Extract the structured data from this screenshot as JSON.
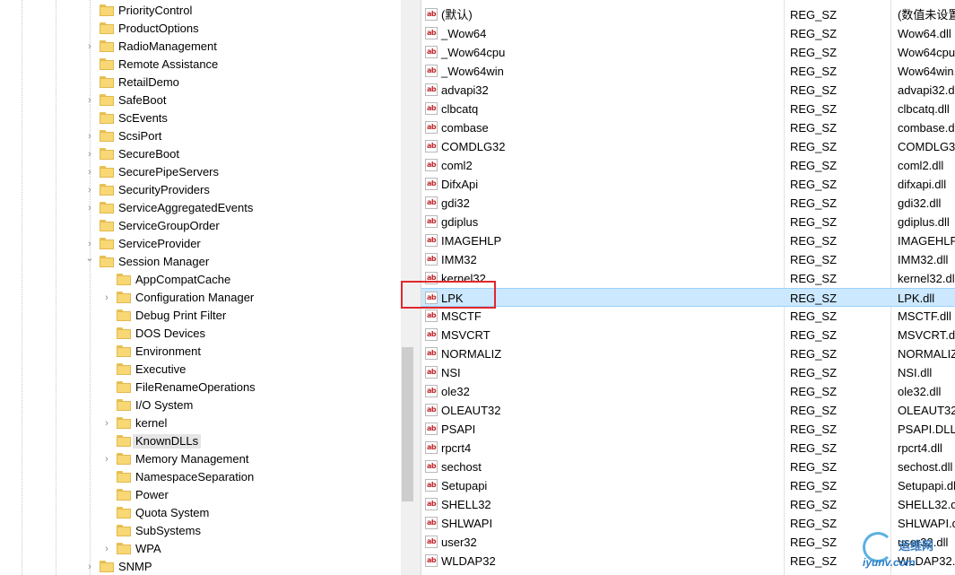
{
  "tree": {
    "items": [
      {
        "label": "PriorityControl",
        "expandable": false,
        "level": 1
      },
      {
        "label": "ProductOptions",
        "expandable": false,
        "level": 1
      },
      {
        "label": "RadioManagement",
        "expandable": true,
        "level": 1
      },
      {
        "label": "Remote Assistance",
        "expandable": false,
        "level": 1
      },
      {
        "label": "RetailDemo",
        "expandable": false,
        "level": 1
      },
      {
        "label": "SafeBoot",
        "expandable": true,
        "level": 1
      },
      {
        "label": "ScEvents",
        "expandable": false,
        "level": 1
      },
      {
        "label": "ScsiPort",
        "expandable": true,
        "level": 1
      },
      {
        "label": "SecureBoot",
        "expandable": true,
        "level": 1
      },
      {
        "label": "SecurePipeServers",
        "expandable": true,
        "level": 1
      },
      {
        "label": "SecurityProviders",
        "expandable": true,
        "level": 1
      },
      {
        "label": "ServiceAggregatedEvents",
        "expandable": true,
        "level": 1
      },
      {
        "label": "ServiceGroupOrder",
        "expandable": false,
        "level": 1
      },
      {
        "label": "ServiceProvider",
        "expandable": true,
        "level": 1
      },
      {
        "label": "Session Manager",
        "expandable": true,
        "expanded": true,
        "level": 1
      },
      {
        "label": "AppCompatCache",
        "expandable": false,
        "level": 2
      },
      {
        "label": "Configuration Manager",
        "expandable": true,
        "level": 2
      },
      {
        "label": "Debug Print Filter",
        "expandable": false,
        "level": 2
      },
      {
        "label": "DOS Devices",
        "expandable": false,
        "level": 2
      },
      {
        "label": "Environment",
        "expandable": false,
        "level": 2
      },
      {
        "label": "Executive",
        "expandable": false,
        "level": 2
      },
      {
        "label": "FileRenameOperations",
        "expandable": false,
        "level": 2
      },
      {
        "label": "I/O System",
        "expandable": false,
        "level": 2
      },
      {
        "label": "kernel",
        "expandable": true,
        "level": 2
      },
      {
        "label": "KnownDLLs",
        "expandable": false,
        "level": 2,
        "selected": true
      },
      {
        "label": "Memory Management",
        "expandable": true,
        "level": 2
      },
      {
        "label": "NamespaceSeparation",
        "expandable": false,
        "level": 2
      },
      {
        "label": "Power",
        "expandable": false,
        "level": 2
      },
      {
        "label": "Quota System",
        "expandable": false,
        "level": 2
      },
      {
        "label": "SubSystems",
        "expandable": false,
        "level": 2
      },
      {
        "label": "WPA",
        "expandable": true,
        "level": 2
      },
      {
        "label": "SNMP",
        "expandable": true,
        "level": 1
      }
    ]
  },
  "values": {
    "rows": [
      {
        "name": "(默认)",
        "type": "REG_SZ",
        "data": "(数值未设置"
      },
      {
        "name": "_Wow64",
        "type": "REG_SZ",
        "data": "Wow64.dll"
      },
      {
        "name": "_Wow64cpu",
        "type": "REG_SZ",
        "data": "Wow64cpu"
      },
      {
        "name": "_Wow64win",
        "type": "REG_SZ",
        "data": "Wow64win."
      },
      {
        "name": "advapi32",
        "type": "REG_SZ",
        "data": "advapi32.d"
      },
      {
        "name": "clbcatq",
        "type": "REG_SZ",
        "data": "clbcatq.dll"
      },
      {
        "name": "combase",
        "type": "REG_SZ",
        "data": "combase.d"
      },
      {
        "name": "COMDLG32",
        "type": "REG_SZ",
        "data": "COMDLG32"
      },
      {
        "name": "coml2",
        "type": "REG_SZ",
        "data": "coml2.dll"
      },
      {
        "name": "DifxApi",
        "type": "REG_SZ",
        "data": "difxapi.dll"
      },
      {
        "name": "gdi32",
        "type": "REG_SZ",
        "data": "gdi32.dll"
      },
      {
        "name": "gdiplus",
        "type": "REG_SZ",
        "data": "gdiplus.dll"
      },
      {
        "name": "IMAGEHLP",
        "type": "REG_SZ",
        "data": "IMAGEHLP."
      },
      {
        "name": "IMM32",
        "type": "REG_SZ",
        "data": "IMM32.dll"
      },
      {
        "name": "kernel32",
        "type": "REG_SZ",
        "data": "kernel32.dl"
      },
      {
        "name": "LPK",
        "type": "REG_SZ",
        "data": "LPK.dll",
        "selected": true
      },
      {
        "name": "MSCTF",
        "type": "REG_SZ",
        "data": "MSCTF.dll"
      },
      {
        "name": "MSVCRT",
        "type": "REG_SZ",
        "data": "MSVCRT.dll"
      },
      {
        "name": "NORMALIZ",
        "type": "REG_SZ",
        "data": "NORMALIZ"
      },
      {
        "name": "NSI",
        "type": "REG_SZ",
        "data": "NSI.dll"
      },
      {
        "name": "ole32",
        "type": "REG_SZ",
        "data": "ole32.dll"
      },
      {
        "name": "OLEAUT32",
        "type": "REG_SZ",
        "data": "OLEAUT32."
      },
      {
        "name": "PSAPI",
        "type": "REG_SZ",
        "data": "PSAPI.DLL"
      },
      {
        "name": "rpcrt4",
        "type": "REG_SZ",
        "data": "rpcrt4.dll"
      },
      {
        "name": "sechost",
        "type": "REG_SZ",
        "data": "sechost.dll"
      },
      {
        "name": "Setupapi",
        "type": "REG_SZ",
        "data": "Setupapi.dl"
      },
      {
        "name": "SHELL32",
        "type": "REG_SZ",
        "data": "SHELL32.dl"
      },
      {
        "name": "SHLWAPI",
        "type": "REG_SZ",
        "data": "SHLWAPI.dl"
      },
      {
        "name": "user32",
        "type": "REG_SZ",
        "data": "user32.dll"
      },
      {
        "name": "WLDAP32",
        "type": "REG_SZ",
        "data": "WLDAP32.dll"
      }
    ],
    "icon_text": "ab"
  },
  "watermark": {
    "title": "运维网",
    "subtitle": "iyunv.com"
  },
  "colors": {
    "selection": "#cce8ff",
    "highlight_border": "#e0282c",
    "folder": "#f8d775"
  }
}
